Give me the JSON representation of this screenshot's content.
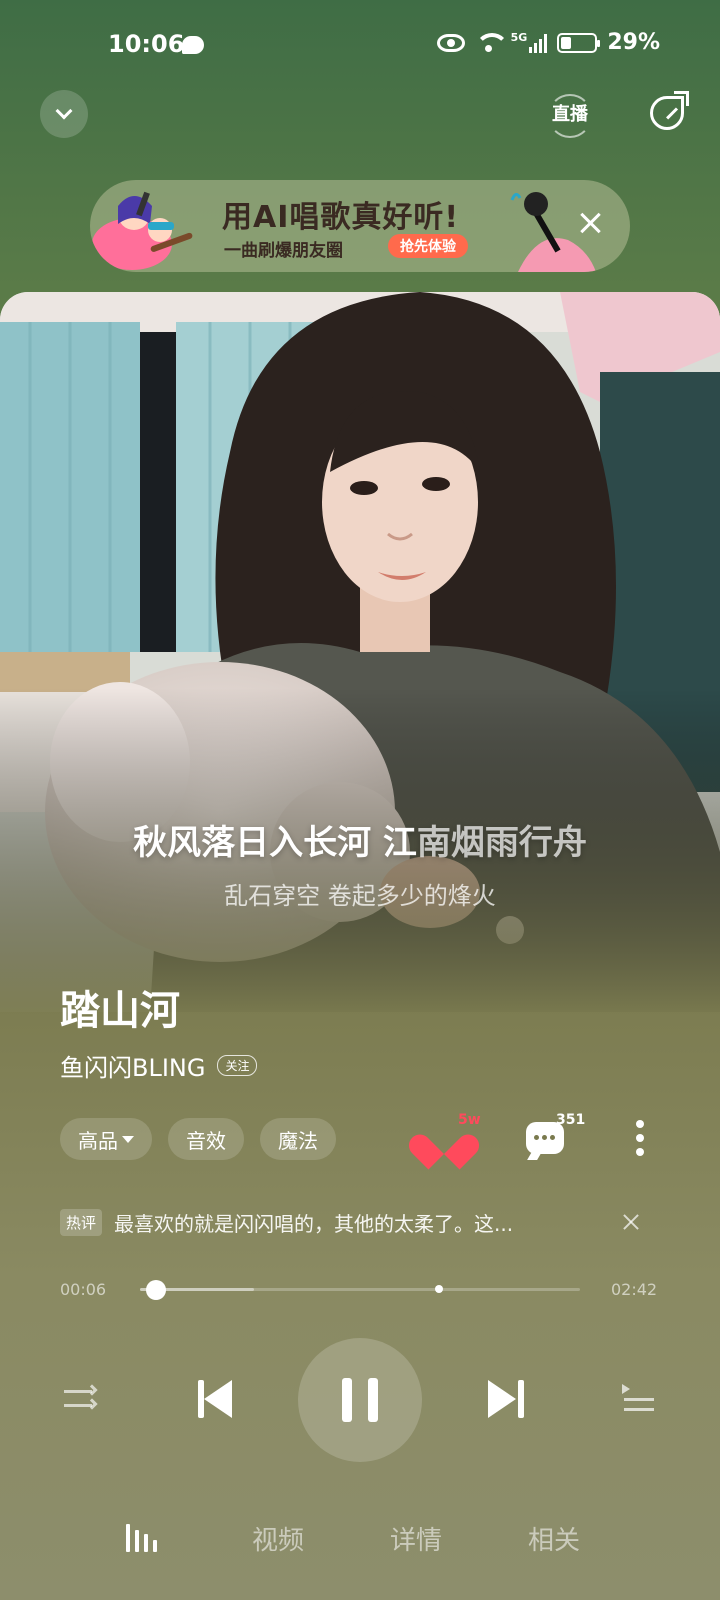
{
  "status_bar": {
    "time": "10:06",
    "network": "5G",
    "battery": "29%"
  },
  "top_bar": {
    "live_label": "直播"
  },
  "banner": {
    "title": "用AI唱歌真好听!",
    "subtitle": "一曲刷爆朋友圈",
    "cta": "抢先体验"
  },
  "lyrics": {
    "current_lit": "秋风落日入长河 江",
    "current_dim": "南烟雨行舟",
    "next": "乱石穿空 卷起多少的烽火"
  },
  "song": {
    "title": "踏山河",
    "artist": "鱼闪闪BLING",
    "follow_label": "关注"
  },
  "tags": {
    "quality": "高品",
    "effect": "音效",
    "magic": "魔法"
  },
  "actions": {
    "like_count": "5w",
    "comment_count": "351"
  },
  "hot_comment": {
    "badge": "热评",
    "text": "最喜欢的就是闪闪唱的，其他的太柔了。这..."
  },
  "progress": {
    "current_time": "00:06",
    "total_time": "02:42",
    "played_fraction": 0.037,
    "buffered_fraction": 0.26,
    "marker_fraction": 0.68
  },
  "bottom_tabs": {
    "video": "视频",
    "detail": "详情",
    "related": "相关"
  },
  "colors": {
    "like": "#ff4a5c",
    "banner_cta": "#ff6a4c"
  }
}
